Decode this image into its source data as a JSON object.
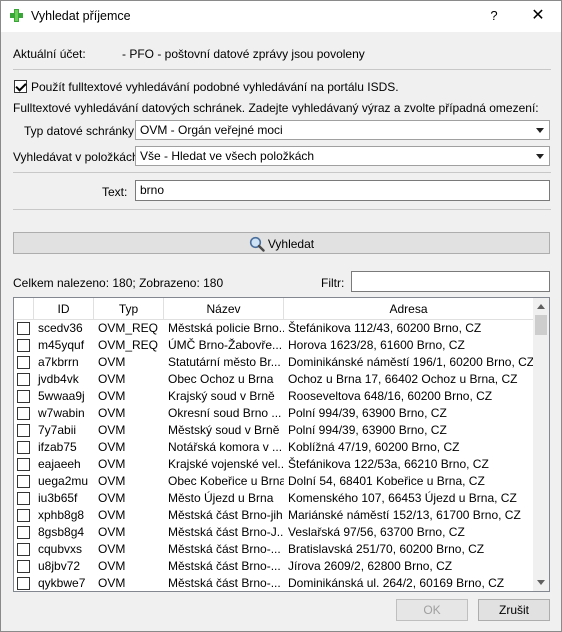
{
  "window": {
    "title": "Vyhledat příjemce",
    "help": "?",
    "close": "✕"
  },
  "account": {
    "label": "Aktuální účet:",
    "value": "- PFO - poštovní datové zprávy jsou povoleny"
  },
  "fulltext": {
    "checkbox_label": "Použít fulltextové vyhledávání podobné vyhledávání na portálu ISDS.",
    "checked": true,
    "description": "Fulltextové vyhledávání datových schránek. Zadejte vyhledávaný výraz a zvolte případná omezení:"
  },
  "box_type": {
    "label": "Typ datové schránky:",
    "value": "OVM - Orgán veřejné moci"
  },
  "search_in": {
    "label": "Vyhledávat v položkách:",
    "value": "Vše - Hledat ve všech položkách"
  },
  "text_field": {
    "label": "Text:",
    "value": "brno"
  },
  "search_button": {
    "label": "Vyhledat"
  },
  "results": {
    "summary": "Celkem nalezeno: 180; Zobrazeno: 180",
    "filter_label": "Filtr:",
    "filter_value": ""
  },
  "table": {
    "columns": [
      "ID",
      "Typ",
      "Název",
      "Adresa"
    ],
    "rows": [
      {
        "id": "scedv36",
        "typ": "OVM_REQ",
        "nazev": "Městská policie Brno...",
        "adresa": "Štefánikova 112/43, 60200 Brno, CZ"
      },
      {
        "id": "m45yquf",
        "typ": "OVM_REQ",
        "nazev": "ÚMČ Brno-Žabovře...",
        "adresa": "Horova 1623/28, 61600 Brno, CZ"
      },
      {
        "id": "a7kbrrn",
        "typ": "OVM",
        "nazev": "Statutární město Br...",
        "adresa": "Dominikánské náměstí 196/1, 60200 Brno, CZ"
      },
      {
        "id": "jvdb4vk",
        "typ": "OVM",
        "nazev": "Obec Ochoz u Brna",
        "adresa": "Ochoz u Brna 17, 66402 Ochoz u Brna, CZ"
      },
      {
        "id": "5wwaa9j",
        "typ": "OVM",
        "nazev": "Krajský soud v Brně",
        "adresa": "Rooseveltova 648/16, 60200 Brno, CZ"
      },
      {
        "id": "w7wabin",
        "typ": "OVM",
        "nazev": "Okresní soud Brno ...",
        "adresa": "Polní 994/39, 63900 Brno, CZ"
      },
      {
        "id": "7y7abii",
        "typ": "OVM",
        "nazev": "Městský soud v Brně",
        "adresa": "Polní 994/39, 63900 Brno, CZ"
      },
      {
        "id": "ifzab75",
        "typ": "OVM",
        "nazev": "Notářská komora v ...",
        "adresa": "Koblížná 47/19, 60200 Brno, CZ"
      },
      {
        "id": "eajaeeh",
        "typ": "OVM",
        "nazev": "Krajské vojenské vel...",
        "adresa": "Štefánikova 122/53a, 66210 Brno, CZ"
      },
      {
        "id": "uega2mu",
        "typ": "OVM",
        "nazev": "Obec Kobeřice u Brna",
        "adresa": "Dolní 54, 68401 Kobeřice u Brna, CZ"
      },
      {
        "id": "iu3b65f",
        "typ": "OVM",
        "nazev": "Město Újezd u Brna",
        "adresa": "Komenského 107, 66453 Újezd u Brna, CZ"
      },
      {
        "id": "xphb8g8",
        "typ": "OVM",
        "nazev": "Městská část Brno-jih",
        "adresa": "Mariánské náměstí 152/13, 61700 Brno, CZ"
      },
      {
        "id": "8gsb8g4",
        "typ": "OVM",
        "nazev": "Městská část Brno-J...",
        "adresa": "Veslařská 97/56, 63700 Brno, CZ"
      },
      {
        "id": "cqubvxs",
        "typ": "OVM",
        "nazev": "Městská část Brno-...",
        "adresa": "Bratislavská 251/70, 60200 Brno, CZ"
      },
      {
        "id": "u8jbv72",
        "typ": "OVM",
        "nazev": "Městská část Brno-...",
        "adresa": "Jírova 2609/2, 62800 Brno, CZ"
      },
      {
        "id": "qykbwe7",
        "typ": "OVM",
        "nazev": "Městská část Brno-...",
        "adresa": "Dominikánská ul. 264/2, 60169 Brno, CZ"
      }
    ]
  },
  "footer": {
    "ok_label": "OK",
    "cancel_label": "Zrušit"
  },
  "colors": {
    "window_bg": "#f0f0f0",
    "icon_green": "#3aa63a"
  },
  "icons": {
    "app": "plus-icon",
    "search": "magnifier-icon"
  }
}
